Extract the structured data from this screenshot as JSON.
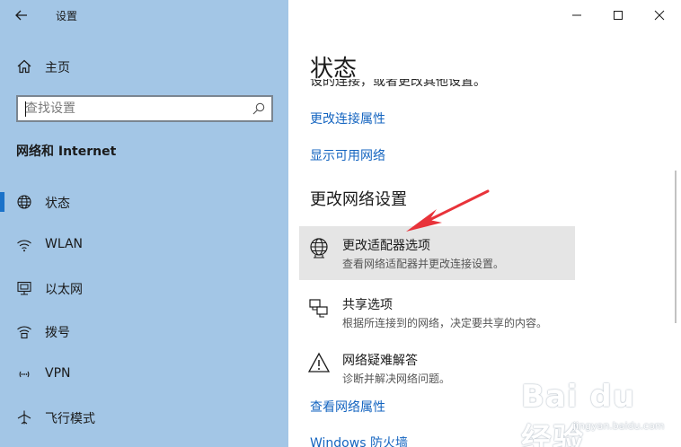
{
  "window": {
    "title": "设置",
    "controls": [
      "minimize",
      "maximize",
      "close"
    ]
  },
  "sidebar": {
    "home_label": "主页",
    "search_placeholder": "查找设置",
    "section_title": "网络和 Internet",
    "items": [
      {
        "label": "状态",
        "icon": "globe-icon",
        "active": true
      },
      {
        "label": "WLAN",
        "icon": "wifi-icon",
        "active": false
      },
      {
        "label": "以太网",
        "icon": "ethernet-icon",
        "active": false
      },
      {
        "label": "拨号",
        "icon": "dialup-icon",
        "active": false
      },
      {
        "label": "VPN",
        "icon": "vpn-icon",
        "active": false
      },
      {
        "label": "飞行模式",
        "icon": "airplane-icon",
        "active": false
      }
    ]
  },
  "main": {
    "title": "状态",
    "cutoff_text": "设的连接，或者更改其他设置。",
    "links_top": [
      "更改连接属性",
      "显示可用网络"
    ],
    "sub_heading": "更改网络设置",
    "options": [
      {
        "title": "更改适配器选项",
        "desc": "查看网络适配器并更改连接设置。",
        "icon": "adapter-globe-icon"
      },
      {
        "title": "共享选项",
        "desc": "根据所连接到的网络，决定要共享的内容。",
        "icon": "sharing-icon"
      },
      {
        "title": "网络疑难解答",
        "desc": "诊断并解决网络问题。",
        "icon": "warning-icon"
      }
    ],
    "links_bottom": [
      "查看网络属性",
      "Windows 防火墙"
    ]
  },
  "colors": {
    "sidebar_bg": "#a3c6e6",
    "accent": "#1a72c9",
    "link": "#1565c0",
    "arrow": "#e8333a"
  },
  "watermark": {
    "main": "Bai du 经验",
    "sub": "jingyan.baidu.com"
  }
}
